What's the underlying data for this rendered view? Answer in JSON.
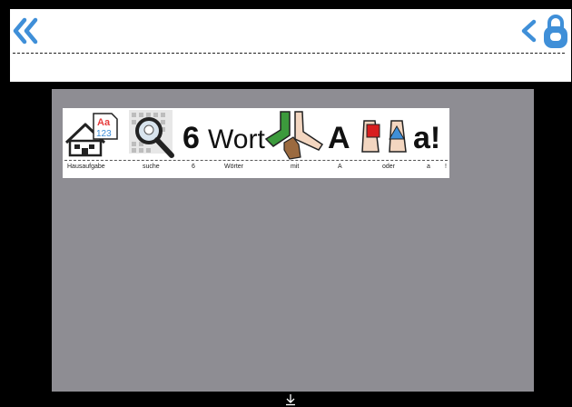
{
  "header": {
    "back_double_icon": "double-chevron-left-icon",
    "back_icon": "chevron-left-icon",
    "lock_icon": "lock-icon",
    "accent": "#3f8fd8"
  },
  "sentence": {
    "picto_text": {
      "homework_letters": "Aa",
      "homework_numbers": "123",
      "number": "6",
      "word": "Wort",
      "letter_upper": "A",
      "letter_lower": "a!"
    },
    "words": [
      {
        "text": "Hausaufgabe"
      },
      {
        "text": "suche"
      },
      {
        "text": "6"
      },
      {
        "text": "Wörter"
      },
      {
        "text": "mit"
      },
      {
        "text": "A"
      },
      {
        "text": "oder"
      },
      {
        "text": "a"
      },
      {
        "text": "!"
      }
    ]
  },
  "footer": {
    "download_icon": "download-arrow-icon"
  }
}
